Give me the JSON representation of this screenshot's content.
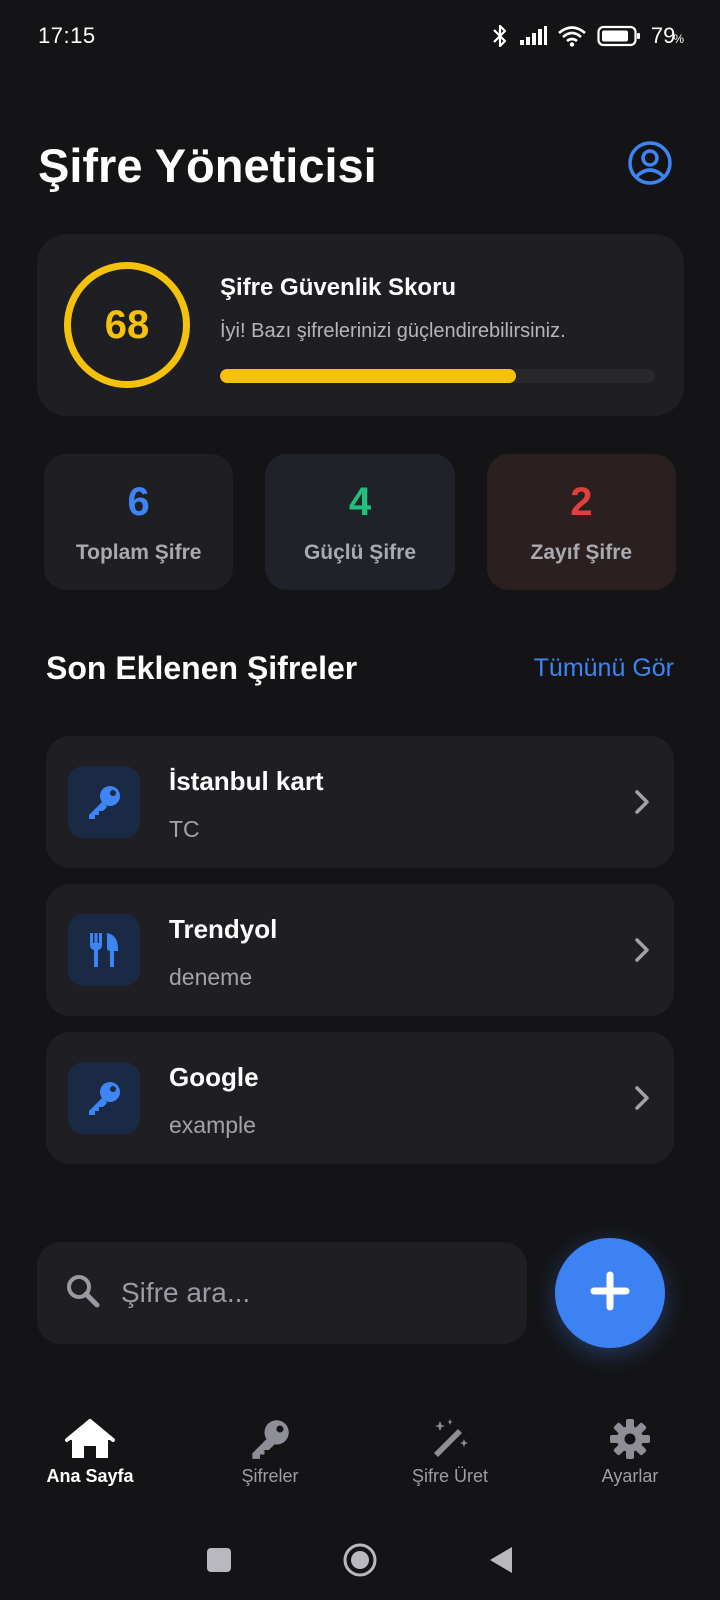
{
  "status_bar": {
    "time": "17:15",
    "battery": "79",
    "battery_unit": "%"
  },
  "header": {
    "title": "Şifre Yöneticisi"
  },
  "score": {
    "value": "68",
    "title": "Şifre Güvenlik Skoru",
    "description": "İyi! Bazı şifrelerinizi güçlendirebilirsiniz.",
    "progress": 0.68,
    "color": "#f5c20b"
  },
  "stats": [
    {
      "value": "6",
      "label": "Toplam Şifre",
      "color": "#3d85f5",
      "bg": "#1f1f23"
    },
    {
      "value": "4",
      "label": "Güçlü Şifre",
      "color": "#22c17b",
      "bg": "#1f2229"
    },
    {
      "value": "2",
      "label": "Zayıf Şifre",
      "color": "#e53e3e",
      "bg": "#2b2020"
    }
  ],
  "recent": {
    "title": "Son Eklenen Şifreler",
    "see_all": "Tümünü Gör",
    "items": [
      {
        "name": "İstanbul kart",
        "username": "TC",
        "icon": "key-icon"
      },
      {
        "name": "Trendyol",
        "username": "deneme",
        "icon": "utensils-icon"
      },
      {
        "name": "Google",
        "username": "example",
        "icon": "key-icon"
      }
    ]
  },
  "search": {
    "placeholder": "Şifre ara..."
  },
  "nav": [
    {
      "label": "Ana Sayfa",
      "icon": "home-icon",
      "active": true
    },
    {
      "label": "Şifreler",
      "icon": "key-icon",
      "active": false
    },
    {
      "label": "Şifre Üret",
      "icon": "magic-wand-icon",
      "active": false
    },
    {
      "label": "Ayarlar",
      "icon": "gear-icon",
      "active": false
    }
  ],
  "colors": {
    "accent": "#3d82f3",
    "background": "#141416",
    "card": "#1f1f23"
  }
}
